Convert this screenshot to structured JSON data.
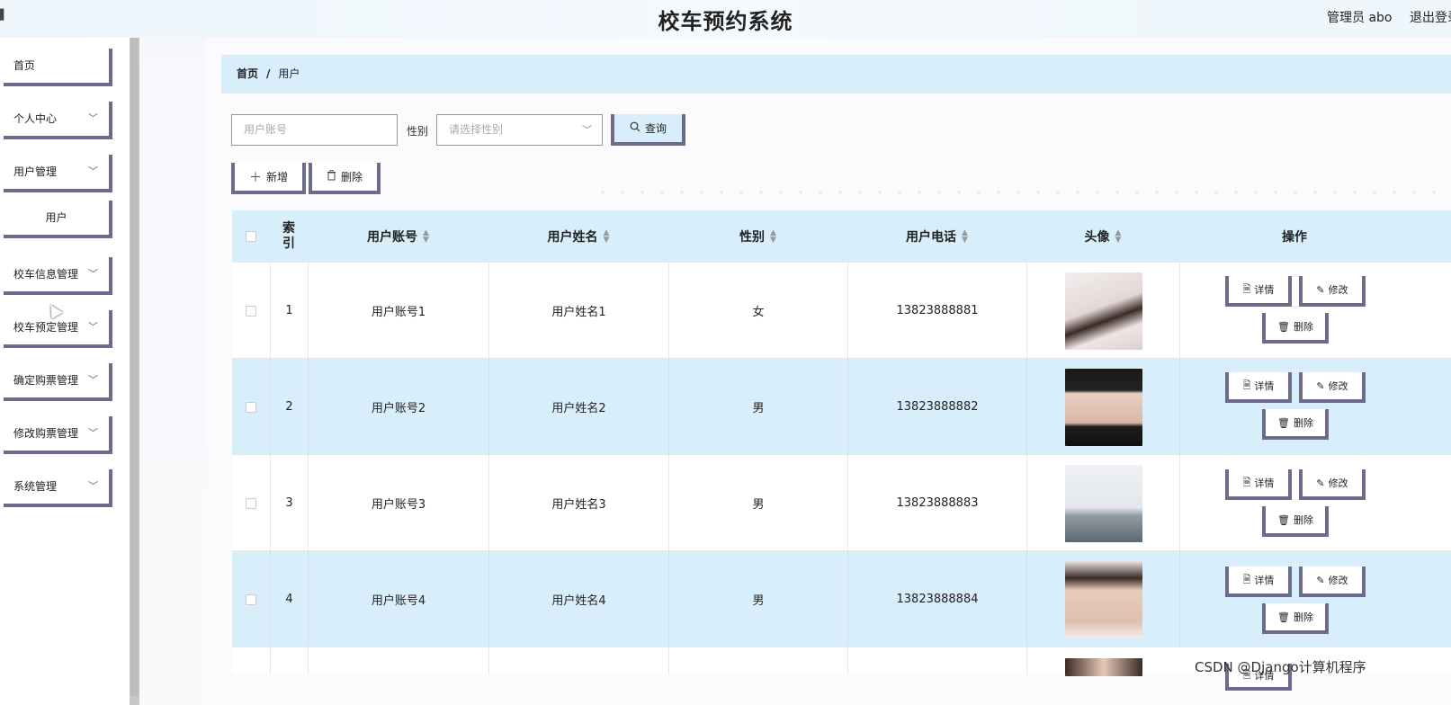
{
  "header": {
    "title": "校车预约系统",
    "user": "管理员 abo",
    "logout": "退出登录"
  },
  "sidebar": {
    "items": [
      {
        "label": "首页"
      },
      {
        "label": "个人中心"
      },
      {
        "label": "用户管理"
      },
      {
        "label": "用户"
      },
      {
        "label": "校车信息管理"
      },
      {
        "label": "校车预定管理"
      },
      {
        "label": "确定购票管理"
      },
      {
        "label": "修改购票管理"
      },
      {
        "label": "系统管理"
      }
    ]
  },
  "breadcrumb": {
    "home": "首页",
    "separator": "/",
    "current": "用户"
  },
  "search": {
    "account_placeholder": "用户账号",
    "gender_label": "性别",
    "gender_placeholder": "请选择性别",
    "query_label": "查询"
  },
  "actions": {
    "add_label": "新增",
    "delete_label": "删除"
  },
  "table": {
    "columns": {
      "index": "索引",
      "account": "用户账号",
      "name": "用户姓名",
      "gender": "性别",
      "phone": "用户电话",
      "avatar": "头像",
      "ops": "操作"
    },
    "rows": [
      {
        "index": "1",
        "account": "用户账号1",
        "name": "用户姓名1",
        "gender": "女",
        "phone": "13823888881"
      },
      {
        "index": "2",
        "account": "用户账号2",
        "name": "用户姓名2",
        "gender": "男",
        "phone": "13823888882"
      },
      {
        "index": "3",
        "account": "用户账号3",
        "name": "用户姓名3",
        "gender": "男",
        "phone": "13823888883"
      },
      {
        "index": "4",
        "account": "用户账号4",
        "name": "用户姓名4",
        "gender": "男",
        "phone": "13823888884"
      }
    ],
    "row_actions": {
      "detail": "详情",
      "edit": "修改",
      "delete": "删除"
    }
  },
  "watermark": "CSDN @Django计算机程序",
  "colors": {
    "accent": "#d8eefb",
    "button_border": "#6b6b8e"
  }
}
